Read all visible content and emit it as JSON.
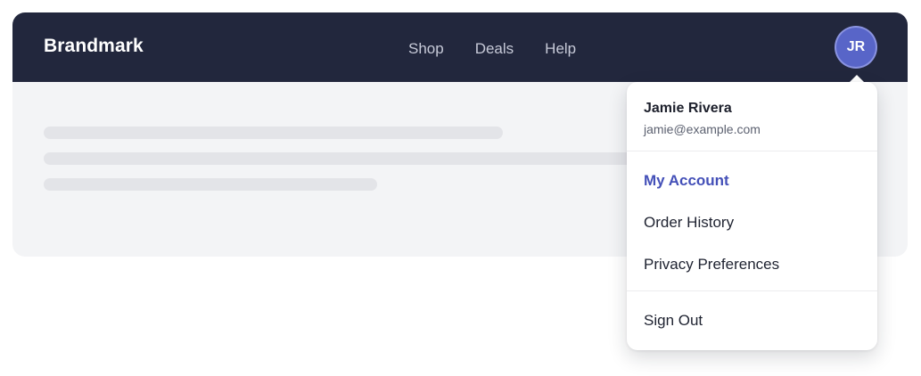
{
  "navbar": {
    "brand": "Brandmark",
    "links": [
      {
        "label": "Shop"
      },
      {
        "label": "Deals"
      },
      {
        "label": "Help"
      }
    ],
    "avatar_initials": "JR"
  },
  "dropdown": {
    "user_name": "Jamie Rivera",
    "user_email": "jamie@example.com",
    "items": [
      {
        "label": "My Account",
        "active": true
      },
      {
        "label": "Order History"
      },
      {
        "label": "Privacy Preferences"
      }
    ],
    "sign_out_label": "Sign Out"
  },
  "colors": {
    "navbar_bg": "#22273d",
    "avatar_bg": "#5865c8",
    "active_item": "#4450b8",
    "page_bg": "#f3f4f6"
  }
}
